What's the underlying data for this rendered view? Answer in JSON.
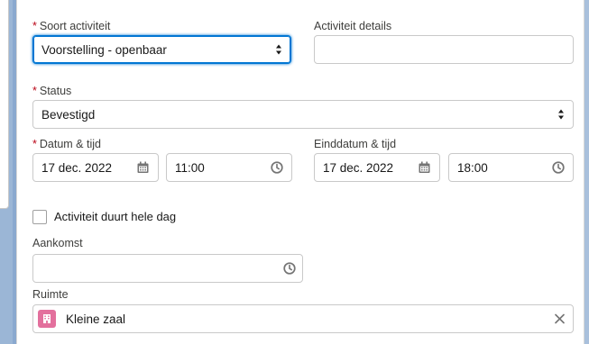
{
  "form": {
    "activity_type": {
      "label": "Soort activiteit",
      "value": "Voorstelling - openbaar"
    },
    "activity_details": {
      "label": "Activiteit details",
      "value": ""
    },
    "status": {
      "label": "Status",
      "value": "Bevestigd"
    },
    "start": {
      "label": "Datum & tijd",
      "date": "17 dec. 2022",
      "time": "11:00"
    },
    "end": {
      "label": "Einddatum & tijd",
      "date": "17 dec. 2022",
      "time": "18:00"
    },
    "all_day": {
      "label": "Activiteit duurt hele dag",
      "checked": false
    },
    "arrival": {
      "label": "Aankomst",
      "value": ""
    },
    "room": {
      "label": "Ruimte",
      "value": "Kleine zaal"
    },
    "required_marker": "*"
  },
  "colors": {
    "required": "#ba0517",
    "focus": "#0176d3",
    "room_icon_bg": "#e3709d"
  },
  "icons": {
    "calendar": "calendar-icon",
    "clock": "clock-icon",
    "clear": "close-icon",
    "room": "building-icon"
  }
}
